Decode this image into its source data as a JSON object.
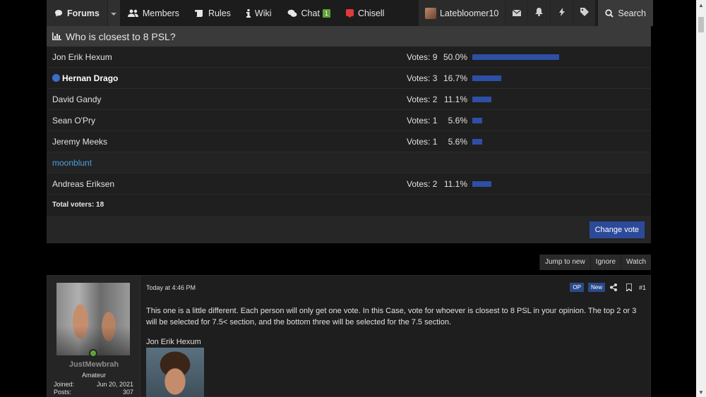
{
  "nav": {
    "forums": "Forums",
    "members": "Members",
    "rules": "Rules",
    "wiki": "Wiki",
    "chat": "Chat",
    "chat_badge": "1",
    "chisell": "Chisell",
    "username": "Latebloomer10",
    "search": "Search"
  },
  "poll": {
    "title": "Who is closest to 8 PSL?",
    "options": [
      {
        "name": "Jon Erik Hexum",
        "votes": "Votes: 9",
        "pct": "50.0%",
        "fraction": 0.5
      },
      {
        "name": "Hernan Drago",
        "votes": "Votes: 3",
        "pct": "16.7%",
        "fraction": 0.167
      },
      {
        "name": "David Gandy",
        "votes": "Votes: 2",
        "pct": "11.1%",
        "fraction": 0.111
      },
      {
        "name": "Sean O'Pry",
        "votes": "Votes: 1",
        "pct": "5.6%",
        "fraction": 0.056
      },
      {
        "name": "Jeremy Meeks",
        "votes": "Votes: 1",
        "pct": "5.6%",
        "fraction": 0.056
      },
      {
        "name": "moonblunt"
      },
      {
        "name": "Andreas Eriksen",
        "votes": "Votes: 2",
        "pct": "11.1%",
        "fraction": 0.111
      }
    ],
    "total": "Total voters: 18",
    "change_vote": "Change vote"
  },
  "thread_actions": {
    "jump": "Jump to new",
    "ignore": "Ignore",
    "watch": "Watch"
  },
  "post": {
    "author": "JustMewbrah",
    "user_title": "Amateur",
    "joined_label": "Joined:",
    "joined_value": "Jun 20, 2021",
    "posts_label": "Posts:",
    "posts_value": "307",
    "date": "Today at 4:46 PM",
    "tag_op": "OP",
    "tag_new": "New",
    "number": "#1",
    "body": "This one is a little different. Each person will only get one vote. In this Case, vote for whoever is closest to 8 PSL in your opinion. The top 2 or 3 will be selected for 7.5< section, and the bottom three will be selected for the 7.5 section.",
    "subheading": "Jon Erik Hexum"
  },
  "colors": {
    "bar": "#2d4fa6",
    "button": "#2d4a9a",
    "link": "#4a9fe0",
    "online": "#5fa33b"
  }
}
